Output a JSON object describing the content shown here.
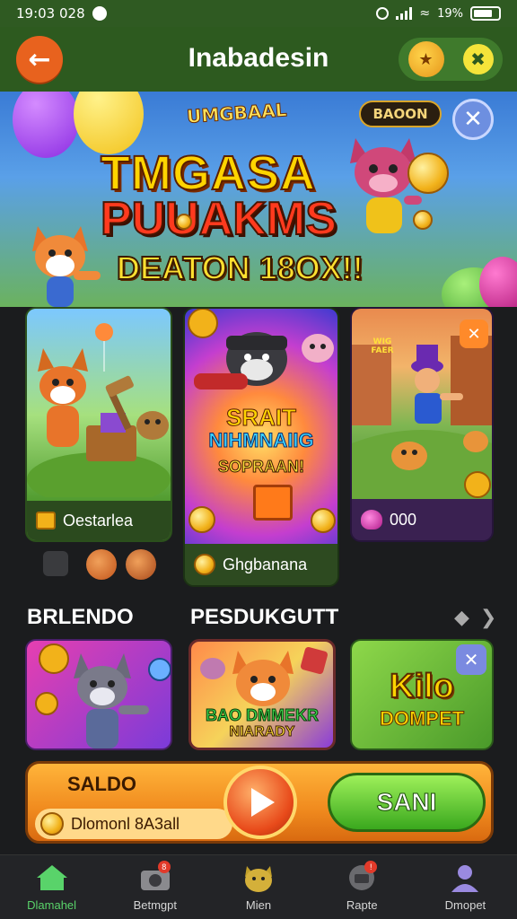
{
  "status_bar": {
    "time": "19:03 028",
    "battery_text": "19%"
  },
  "header": {
    "title": "Inabadesin"
  },
  "banner": {
    "tag": "UMGBAAL",
    "line1": "TMGASA",
    "line2": "PUUAKMS",
    "line3": "DEATON 18OX!!",
    "badge": "BAOON"
  },
  "featured": [
    {
      "label": "Oestarlea",
      "icon": "gift-icon"
    },
    {
      "title_art_1": "SRAIT",
      "title_art_2": "NIHMNAIIG",
      "title_art_3": "SOPRAAN!",
      "label": "Ghgbanana",
      "icon": "coin-icon"
    },
    {
      "label": "000",
      "icon": "heart-icon",
      "art_text": "WIG FAER"
    }
  ],
  "sections": {
    "left_title": "BRLENDO",
    "right_title": "PESDUKGUTT"
  },
  "row2": [
    {
      "name": "wolf-game"
    },
    {
      "art_text_1": "BAO DMMEKR",
      "art_text_2": "NIARADY"
    },
    {
      "art_text_1": "Kilo",
      "art_text_2": "DOMPET"
    }
  ],
  "saldo": {
    "label": "SALDO",
    "amount": "Dlomonl 8A3all",
    "send_label": "SANI"
  },
  "bottom_nav": [
    {
      "label": "Dlamahel",
      "icon": "home-icon",
      "active": true
    },
    {
      "label": "Betmgpt",
      "icon": "camera-icon",
      "badge": "8"
    },
    {
      "label": "Mien",
      "icon": "mascot-icon"
    },
    {
      "label": "Rapte",
      "icon": "wallet-icon",
      "badge": "!"
    },
    {
      "label": "Dmopet",
      "icon": "profile-icon"
    }
  ],
  "colors": {
    "header": "#2d5a1f",
    "accent_orange": "#e8621e",
    "send_green": "#3aa81e",
    "active_nav": "#59d36a"
  }
}
